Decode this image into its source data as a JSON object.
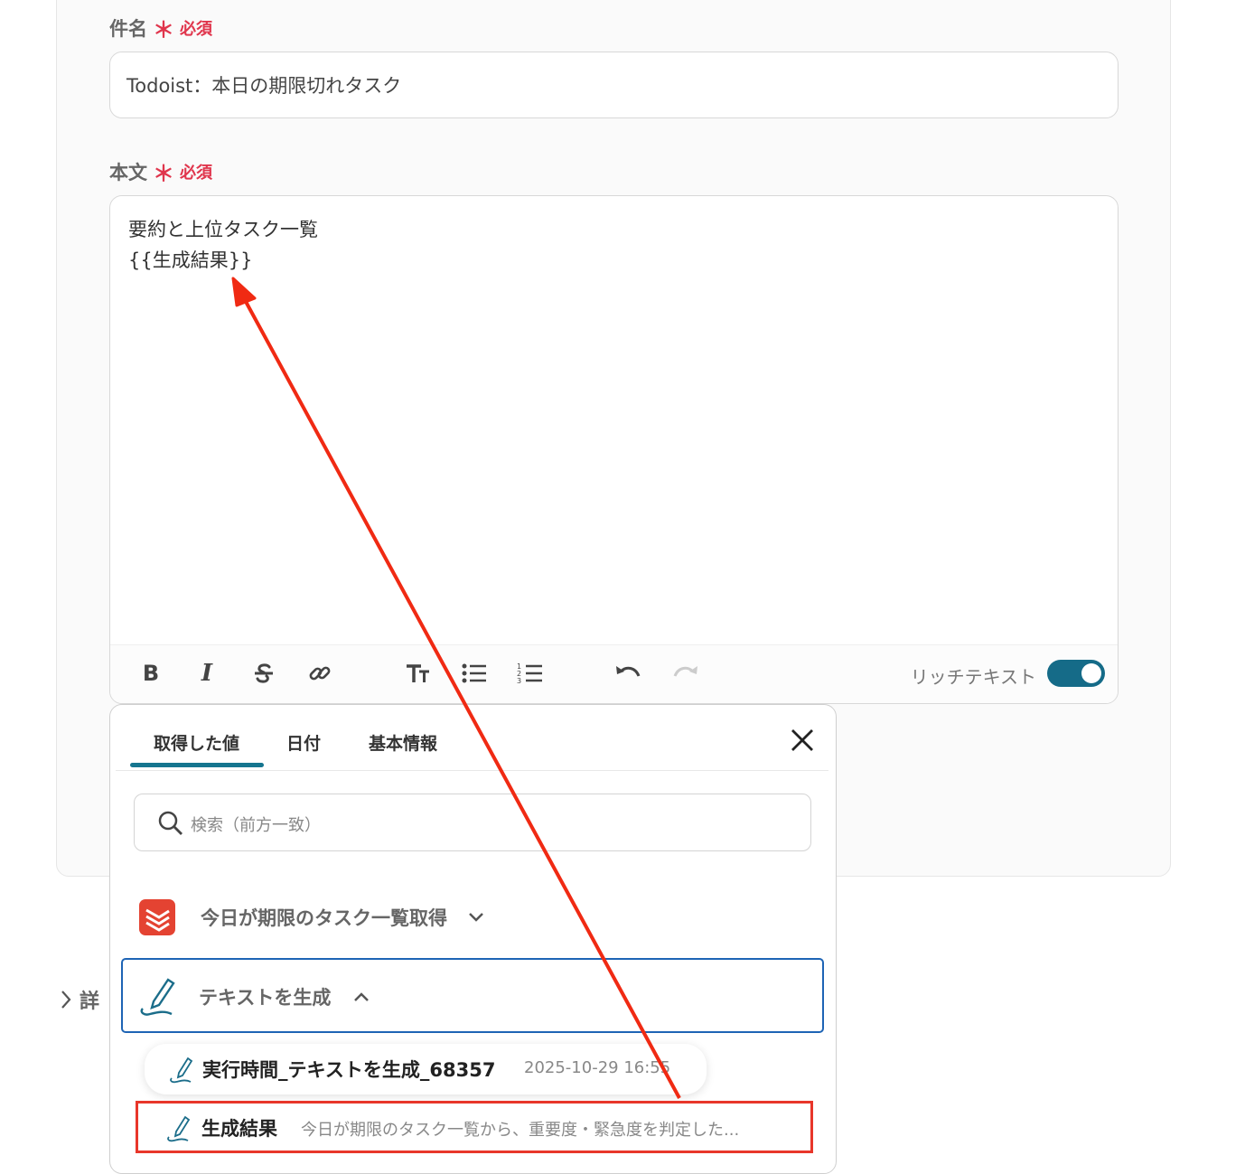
{
  "form": {
    "subject_label": "件名",
    "body_label": "本文",
    "required_mark": "＊",
    "required_text": "必須",
    "subject_value": "Todoist：本日の期限切れタスク",
    "body_line1": "要約と上位タスク一覧",
    "body_line2": "{{生成結果}}"
  },
  "toolbar": {
    "bold": "B",
    "italic": "I",
    "rich_text_label": "リッチテキスト",
    "rich_text_on": true
  },
  "popup": {
    "tabs": [
      "取得した値",
      "日付",
      "基本情報"
    ],
    "active_tab": "取得した値",
    "search_placeholder": "検索（前方一致）",
    "section1_title": "今日が期限のタスク一覧取得",
    "section2_title": "テキストを生成",
    "item1_name": "実行時間_テキストを生成_68357",
    "item1_meta": "2025-10-29 16:55",
    "item2_name": "生成結果",
    "item2_meta": "今日が期限のタスク一覧から、重要度・緊急度を判定した..."
  },
  "detail": {
    "label": "詳"
  },
  "colors": {
    "accent": "#15758f",
    "required": "#e0354c",
    "todoist": "#e44332",
    "highlight": "#e8362a",
    "selected_border": "#1e64b5"
  }
}
